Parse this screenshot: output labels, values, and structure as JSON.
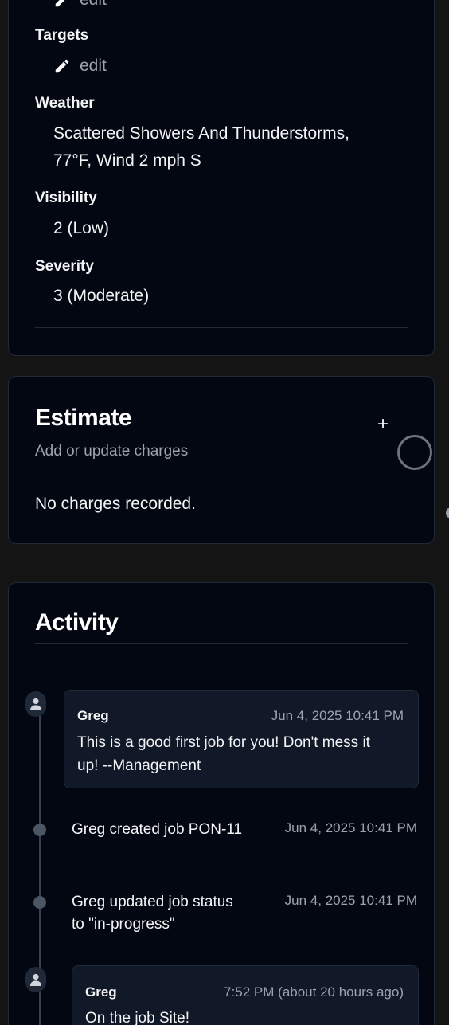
{
  "details": {
    "top_edit_label": "edit",
    "targets_label": "Targets",
    "targets_edit_label": "edit",
    "weather_label": "Weather",
    "weather_line1": "Scattered Showers And Thunderstorms,",
    "weather_line2": "77°F, Wind 2 mph S",
    "visibility_label": "Visibility",
    "visibility_value": "2 (Low)",
    "severity_label": "Severity",
    "severity_value": "3 (Moderate)"
  },
  "estimate": {
    "title": "Estimate",
    "subtitle": "Add or update charges",
    "add_icon": "+",
    "empty_text": "No charges recorded."
  },
  "activity": {
    "title": "Activity",
    "items": [
      {
        "type": "comment",
        "author": "Greg",
        "time": "Jun 4, 2025 10:41 PM",
        "body_line1": "This is a good first job for you! Don't mess it",
        "body_line2": "up! --Management"
      },
      {
        "type": "event",
        "text": "Greg created job PON-11",
        "time": "Jun 4, 2025 10:41 PM"
      },
      {
        "type": "event",
        "text_line1": "Greg updated job status",
        "text_line2": "to \"in-progress\"",
        "time": "Jun 4, 2025 10:41 PM"
      },
      {
        "type": "comment",
        "author": "Greg",
        "time": "7:52 PM (about 20 hours ago)",
        "body_line1": "On the job Site!"
      }
    ]
  },
  "icons": {
    "edit": "pencil-icon",
    "avatar": "user-icon",
    "add": "plus-icon"
  },
  "colors": {
    "page_bg": "#141414",
    "card_bg": "#030712",
    "muted_text": "#9ca3af",
    "comment_bg": "#111827"
  }
}
